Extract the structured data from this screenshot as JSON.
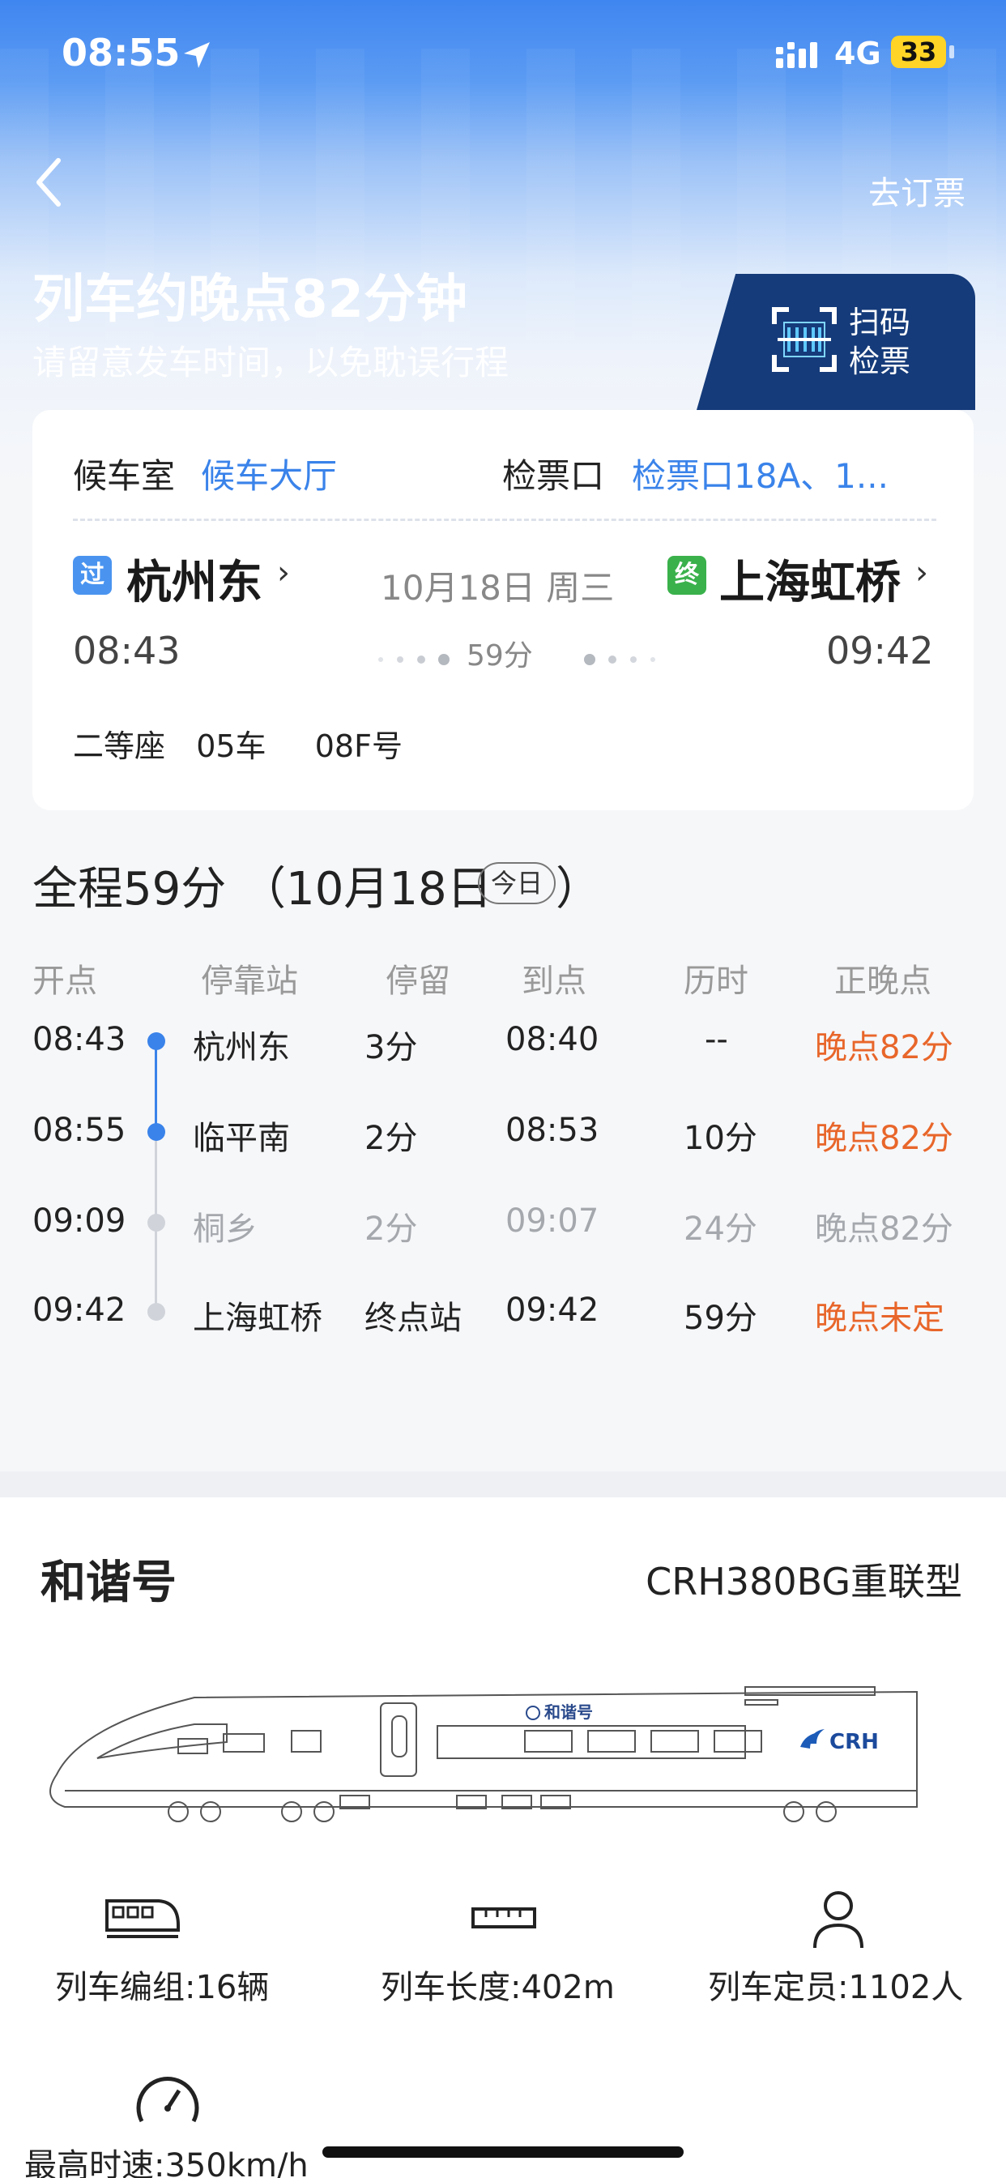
{
  "status_bar": {
    "time": "08:55",
    "network": "4G",
    "battery": "33"
  },
  "header": {
    "book_link": "去订票",
    "delay_title": "列车约晚点82分钟",
    "delay_subtitle": "请留意发车时间，以免耽误行程",
    "scan_label": "扫码检票"
  },
  "ticket_card": {
    "waiting_room_label": "候车室",
    "waiting_room_value": "候车大厅",
    "gate_label": "检票口",
    "gate_value": "检票口18A、1...",
    "from_badge": "过",
    "from_station": "杭州东",
    "to_badge": "终",
    "to_station": "上海虹桥",
    "date": "10月18日 周三",
    "departure_time": "08:43",
    "arrival_time": "09:42",
    "duration": "59分",
    "seat_class": "二等座",
    "car": "05车",
    "seat_no": "08F号"
  },
  "journey": {
    "total": "全程59分 （10月18日",
    "today": "今日",
    "close": "）",
    "headers": [
      "开点",
      "停靠站",
      "停留",
      "到点",
      "历时",
      "正晚点"
    ],
    "stops": [
      {
        "depart": "08:43",
        "station": "杭州东",
        "stay": "3分",
        "arrive": "08:40",
        "elapsed": "--",
        "status": "晚点82分"
      },
      {
        "depart": "08:55",
        "station": "临平南",
        "stay": "2分",
        "arrive": "08:53",
        "elapsed": "10分",
        "status": "晚点82分"
      },
      {
        "depart": "09:09",
        "station": "桐乡",
        "stay": "2分",
        "arrive": "09:07",
        "elapsed": "24分",
        "status": "晚点82分"
      },
      {
        "depart": "09:42",
        "station": "上海虹桥",
        "stay": "终点站",
        "arrive": "09:42",
        "elapsed": "59分",
        "status": "晚点未定"
      }
    ]
  },
  "train_info": {
    "brand": "和谐号",
    "model": "CRH380BG重联型",
    "body_text": "和谐号",
    "logo": "CRH",
    "stats": {
      "formation": "列车编组:16辆",
      "length": "列车长度:402m",
      "capacity": "列车定员:1102人",
      "max_speed": "最高时速:350km/h"
    }
  },
  "colors": {
    "blue": "#3a83ea",
    "late": "#e8662a",
    "pass_badge": "#4a94f0",
    "end_badge": "#3ab14b",
    "scan_bg": "#153b7a"
  }
}
